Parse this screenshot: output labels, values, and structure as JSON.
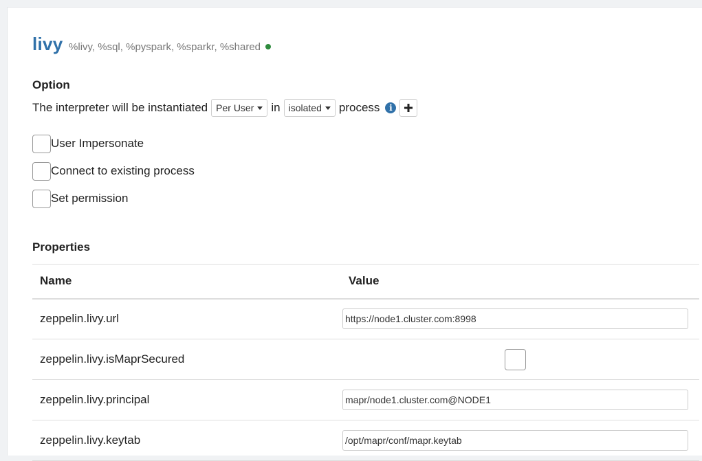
{
  "interpreter": {
    "name": "livy",
    "aliases": "%livy, %sql, %pyspark, %sparkr, %shared",
    "status_color": "#2e8b3d"
  },
  "option": {
    "heading": "Option",
    "sentence_prefix": "The interpreter will be instantiated",
    "per_mode": "Per User",
    "connector": "in",
    "isolation_mode": "isolated",
    "sentence_suffix": "process",
    "info_icon": "info-circle-icon",
    "add_icon": "plus-icon",
    "checkboxes": {
      "user_impersonate": "User Impersonate",
      "connect_existing": "Connect to existing process",
      "set_permission": "Set permission"
    }
  },
  "properties": {
    "heading": "Properties",
    "columns": {
      "name": "Name",
      "value": "Value"
    },
    "rows": [
      {
        "name": "zeppelin.livy.url",
        "value": "https://node1.cluster.com:8998"
      },
      {
        "name": "zeppelin.livy.isMaprSecured",
        "value": ""
      },
      {
        "name": "zeppelin.livy.principal",
        "value": "mapr/node1.cluster.com@NODE1"
      },
      {
        "name": "zeppelin.livy.keytab",
        "value": "/opt/mapr/conf/mapr.keytab"
      }
    ]
  },
  "colors": {
    "title": "#3071a9",
    "status_running": "#2e8b3d"
  }
}
